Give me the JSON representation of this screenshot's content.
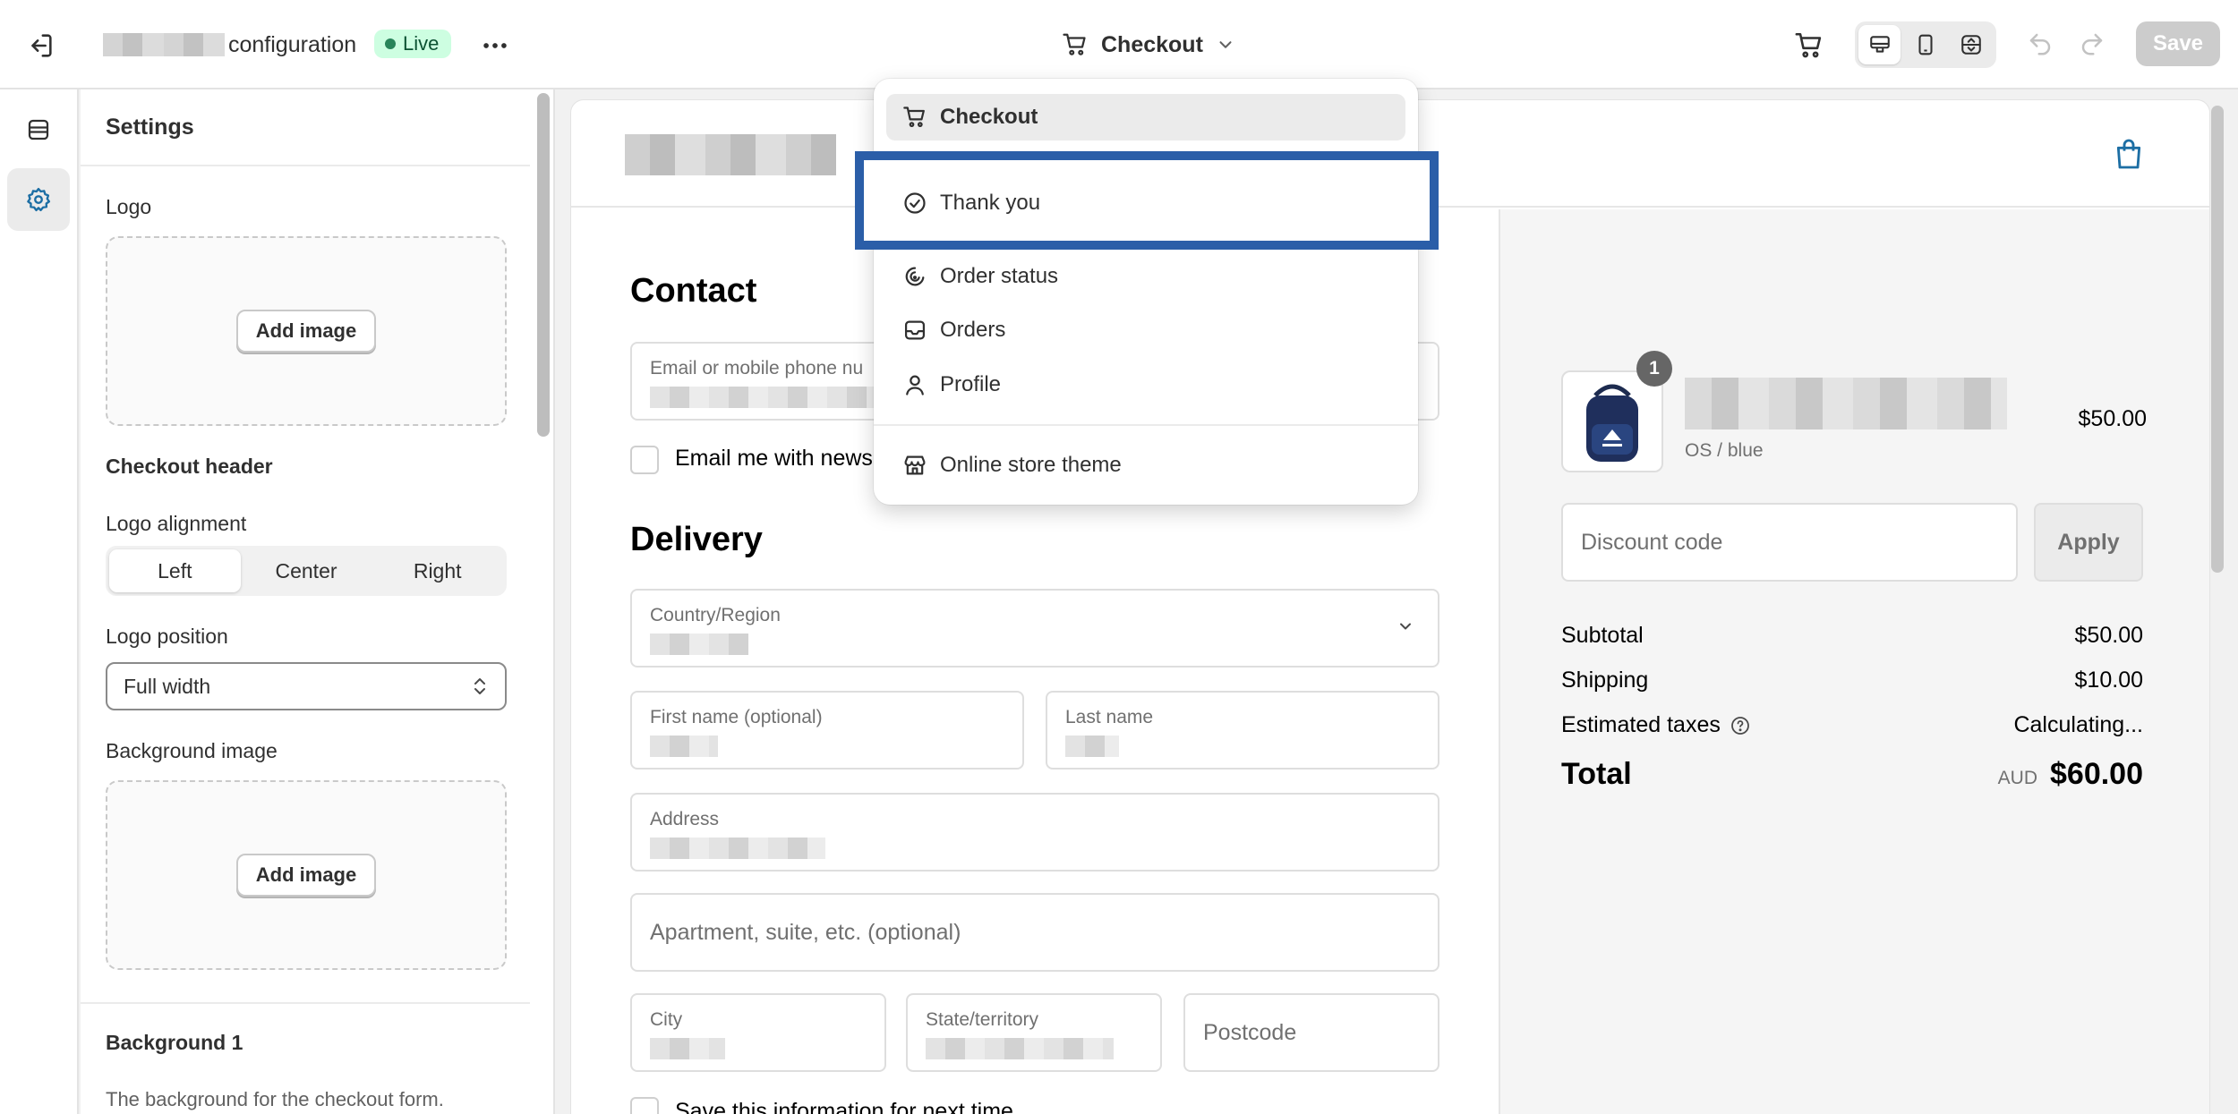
{
  "topbar": {
    "title_suffix": "configuration",
    "live_label": "Live",
    "page_selector_label": "Checkout",
    "save_label": "Save"
  },
  "settings": {
    "title": "Settings",
    "logo_label": "Logo",
    "add_image_label": "Add image",
    "checkout_header_heading": "Checkout header",
    "logo_alignment_label": "Logo alignment",
    "alignment_options": [
      "Left",
      "Center",
      "Right"
    ],
    "alignment_selected": "Left",
    "logo_position_label": "Logo position",
    "logo_position_value": "Full width",
    "background_image_label": "Background image",
    "background_heading": "Background 1",
    "background_desc": "The background for the checkout form."
  },
  "dropdown": {
    "items": [
      {
        "label": "Checkout",
        "icon": "cart-icon"
      },
      {
        "label": "Thank you",
        "icon": "check-circle-icon"
      },
      {
        "label": "Order status",
        "icon": "order-status-icon"
      },
      {
        "label": "Orders",
        "icon": "inbox-icon"
      },
      {
        "label": "Profile",
        "icon": "person-icon"
      },
      {
        "label": "Online store theme",
        "icon": "store-icon"
      }
    ]
  },
  "form": {
    "contact_heading": "Contact",
    "email_label": "Email or mobile phone nu",
    "newsletter_label": "Email me with news",
    "delivery_heading": "Delivery",
    "country_label": "Country/Region",
    "first_name_label": "First name (optional)",
    "last_name_label": "Last name",
    "address_label": "Address",
    "apartment_placeholder": "Apartment, suite, etc. (optional)",
    "city_label": "City",
    "state_label": "State/territory",
    "postcode_placeholder": "Postcode",
    "save_info_label": "Save this information for next time"
  },
  "summary": {
    "qty": "1",
    "variant": "OS / blue",
    "price": "$50.00",
    "discount_placeholder": "Discount code",
    "apply_label": "Apply",
    "subtotal_label": "Subtotal",
    "subtotal_value": "$50.00",
    "shipping_label": "Shipping",
    "shipping_value": "$10.00",
    "taxes_label": "Estimated taxes",
    "taxes_value": "Calculating...",
    "total_label": "Total",
    "currency": "AUD",
    "total_value": "$60.00"
  },
  "colors": {
    "accent": "#2b5ea8",
    "live_bg": "#cdfee1",
    "live_text": "#0c5132",
    "brand_icon": "#1c6ea4"
  }
}
